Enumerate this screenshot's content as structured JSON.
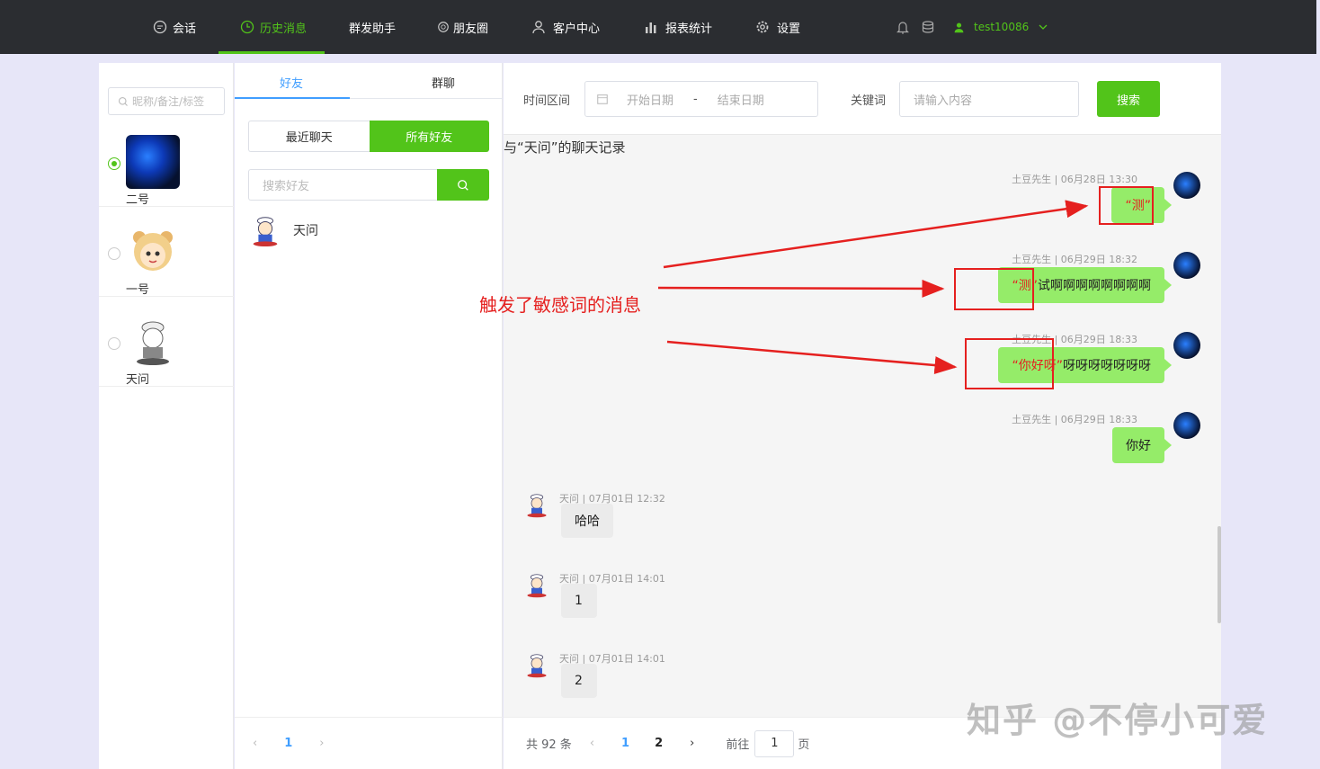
{
  "nav": {
    "items": [
      {
        "label": "会话",
        "icon": "chat-icon"
      },
      {
        "label": "历史消息",
        "icon": "clock-icon"
      },
      {
        "label": "群发助手",
        "icon": ""
      },
      {
        "label": "朋友圈",
        "icon": "aperture-icon"
      },
      {
        "label": "客户中心",
        "icon": "user-icon"
      },
      {
        "label": "报表统计",
        "icon": "bar-chart-icon"
      },
      {
        "label": "设置",
        "icon": "gear-icon"
      }
    ],
    "active_index": 1,
    "user": "test10086",
    "accent": "#52c41a"
  },
  "accounts": {
    "search_placeholder": "昵称/备注/标签",
    "items": [
      {
        "name": "二号",
        "selected": true
      },
      {
        "name": "一号",
        "selected": false
      },
      {
        "name": "天问",
        "selected": false
      }
    ]
  },
  "friends": {
    "tabs": [
      "好友",
      "群聊"
    ],
    "seg": [
      "最近聊天",
      "所有好友"
    ],
    "search_placeholder": "搜索好友",
    "list": [
      {
        "name": "天问"
      }
    ],
    "page": "1"
  },
  "chat": {
    "time_label": "时间区间",
    "start_placeholder": "开始日期",
    "sep": "-",
    "end_placeholder": "结束日期",
    "kw_label": "关键词",
    "kw_placeholder": "请输入内容",
    "search_btn": "搜索",
    "title": "与“天问”的聊天记录",
    "messages": [
      {
        "meta": "土豆先生 | 06月28日 13:30",
        "hl": "“测”",
        "text": ""
      },
      {
        "meta": "土豆先生 | 06月29日 18:32",
        "hl": "“测”",
        "text": "试啊啊啊啊啊啊啊啊"
      },
      {
        "meta": "土豆先生 | 06月29日 18:33",
        "hl": "“你好呀”",
        "text": "呀呀呀呀呀呀呀"
      },
      {
        "meta": "土豆先生 | 06月29日 18:33",
        "hl": "",
        "text": "你好"
      },
      {
        "meta": "天问 | 07月01日 12:32",
        "text": "哈哈"
      },
      {
        "meta": "天问 | 07月01日 14:01",
        "text": "1"
      },
      {
        "meta": "天问 | 07月01日 14:01",
        "text": "2"
      }
    ],
    "pager": {
      "total": "共 92 条",
      "p1": "1",
      "p2": "2",
      "goto": "前往",
      "goto_val": "1",
      "page_word": "页"
    }
  },
  "annotation": "触发了敏感词的消息",
  "watermark": "知乎 @不停小可爱",
  "colors": {
    "green": "#52c41a",
    "bubble": "#95ec69",
    "blue": "#409eff",
    "red": "#e5201f"
  }
}
